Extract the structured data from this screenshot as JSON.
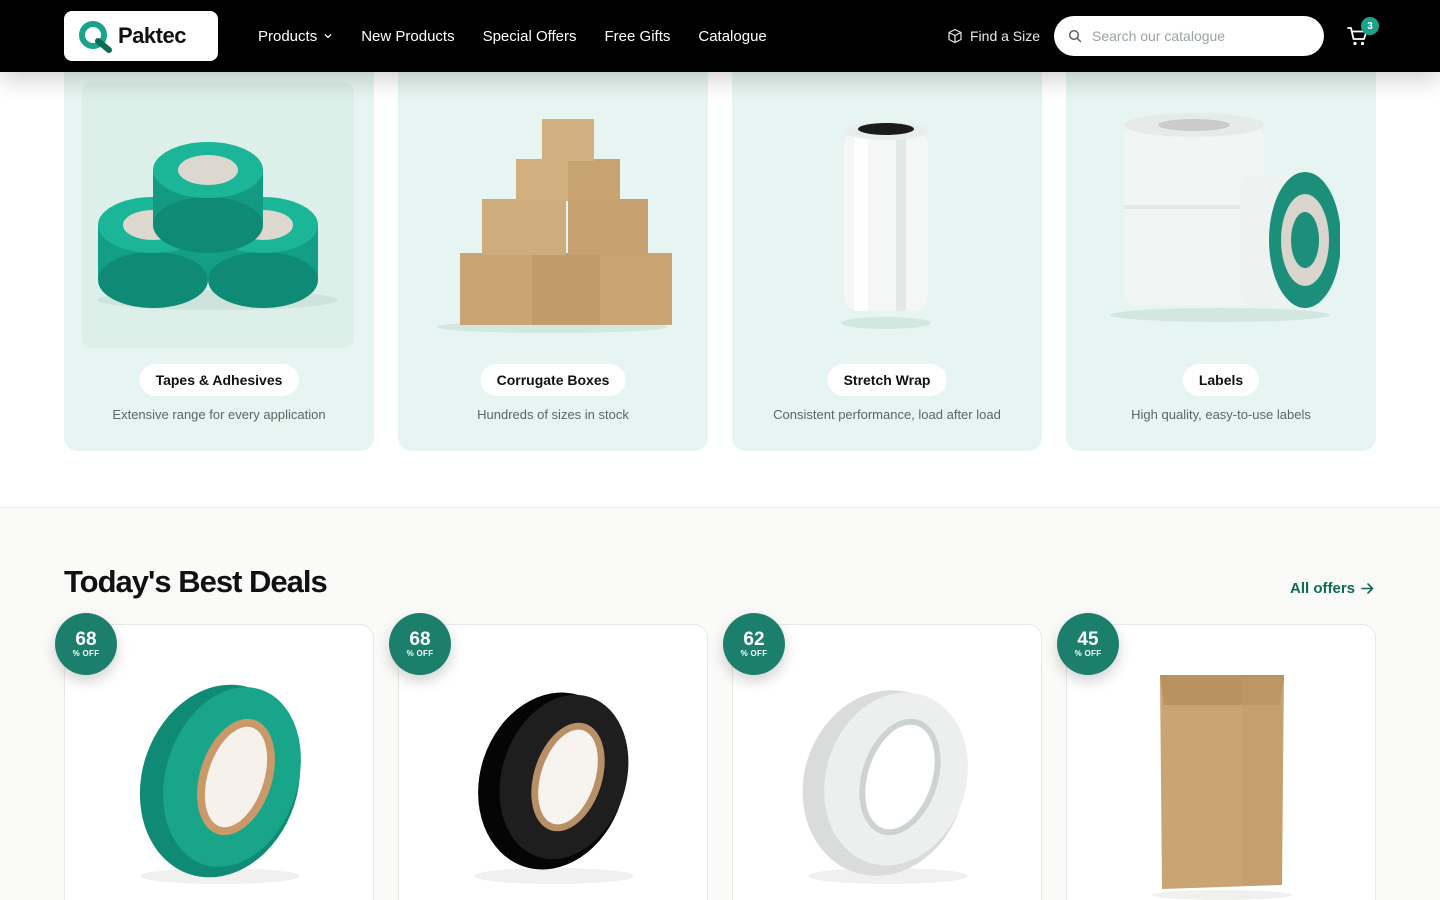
{
  "header": {
    "brand": "Paktec",
    "nav": [
      {
        "label": "Products",
        "has_dropdown": true
      },
      {
        "label": "New Products"
      },
      {
        "label": "Special Offers"
      },
      {
        "label": "Free Gifts"
      },
      {
        "label": "Catalogue"
      }
    ],
    "find_size": "Find a Size",
    "search_placeholder": "Search our catalogue",
    "cart_count": "3"
  },
  "categories": [
    {
      "title": "Tapes & Adhesives",
      "description": "Extensive range for every application",
      "image": "green-tape-rolls"
    },
    {
      "title": "Corrugate Boxes",
      "description": "Hundreds of sizes in stock",
      "image": "cardboard-box-stack"
    },
    {
      "title": "Stretch Wrap",
      "description": "Consistent performance, load after load",
      "image": "stretch-wrap-roll"
    },
    {
      "title": "Labels",
      "description": "High quality, easy-to-use labels",
      "image": "label-rolls"
    }
  ],
  "deals": {
    "title": "Today's Best Deals",
    "all_offers": "All offers",
    "items": [
      {
        "discount": "68",
        "discount_label": "% OFF",
        "image": "green-tape"
      },
      {
        "discount": "68",
        "discount_label": "% OFF",
        "image": "black-tape"
      },
      {
        "discount": "62",
        "discount_label": "% OFF",
        "image": "clear-tape"
      },
      {
        "discount": "45",
        "discount_label": "% OFF",
        "image": "kraft-mailer"
      }
    ]
  },
  "colors": {
    "header_bg": "#000000",
    "accent": "#1b7f6b",
    "card_bg": "#e6f5f1",
    "link": "#0c6b57"
  }
}
